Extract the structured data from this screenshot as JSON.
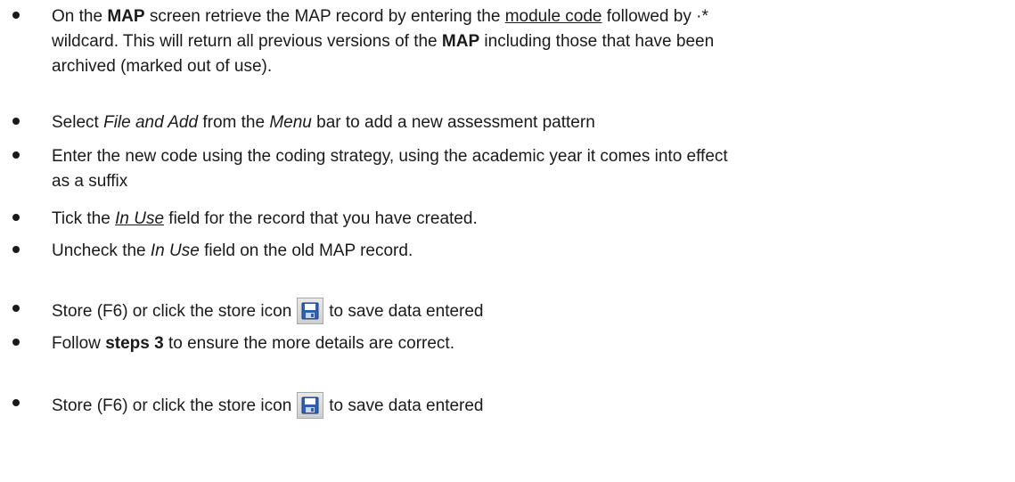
{
  "bullets": [
    {
      "lines": [
        {
          "segments": [
            {
              "text": "On the ",
              "style": ""
            },
            {
              "text": "MAP",
              "style": "b"
            },
            {
              "text": " screen retrieve the MAP record by entering the ",
              "style": ""
            },
            {
              "text": "module code",
              "style": "u"
            },
            {
              "text": " followed by ·*",
              "style": ""
            }
          ]
        },
        {
          "segments": [
            {
              "text": "wildcard. This will return all previous versions of the ",
              "style": ""
            },
            {
              "text": "MAP",
              "style": "b"
            },
            {
              "text": " including those that have been",
              "style": ""
            }
          ]
        },
        {
          "segments": [
            {
              "text": "archived (marked out of use).",
              "style": ""
            }
          ]
        }
      ]
    },
    {
      "lines": [
        {
          "segments": [
            {
              "text": "Select ",
              "style": ""
            },
            {
              "text": "File and Add",
              "style": "i"
            },
            {
              "text": " from the ",
              "style": ""
            },
            {
              "text": "Menu",
              "style": "i"
            },
            {
              "text": " bar to add a new assessment pattern",
              "style": ""
            }
          ]
        }
      ]
    },
    {
      "lines": [
        {
          "segments": [
            {
              "text": "Enter the new code using the coding strategy, using the academic year it comes into effect",
              "style": ""
            }
          ]
        },
        {
          "segments": [
            {
              "text": "as a suffix",
              "style": ""
            }
          ]
        }
      ]
    },
    {
      "lines": [
        {
          "segments": [
            {
              "text": "Tick the ",
              "style": ""
            },
            {
              "text": "In Use",
              "style": "i u"
            },
            {
              "text": " field for the record that you have created.",
              "style": ""
            }
          ]
        }
      ]
    },
    {
      "lines": [
        {
          "segments": [
            {
              "text": "Uncheck the ",
              "style": ""
            },
            {
              "text": "In Use",
              "style": "i"
            },
            {
              "text": " field on the old MAP record.",
              "style": ""
            }
          ]
        }
      ]
    },
    {
      "lines": [
        {
          "segments": [
            {
              "text": "Store (F6) or click the store icon",
              "style": ""
            },
            {
              "icon": "save-icon"
            },
            {
              "text": "to save data entered",
              "style": ""
            }
          ]
        }
      ]
    },
    {
      "lines": [
        {
          "segments": [
            {
              "text": "Follow ",
              "style": ""
            },
            {
              "text": "steps 3",
              "style": "b"
            },
            {
              "text": " to ensure the more details are correct.",
              "style": ""
            }
          ]
        }
      ]
    },
    {
      "lines": [
        {
          "segments": [
            {
              "text": "Store (F6) or click the store icon",
              "style": ""
            },
            {
              "icon": "save-icon"
            },
            {
              "text": "to save data entered",
              "style": ""
            }
          ]
        }
      ]
    }
  ]
}
